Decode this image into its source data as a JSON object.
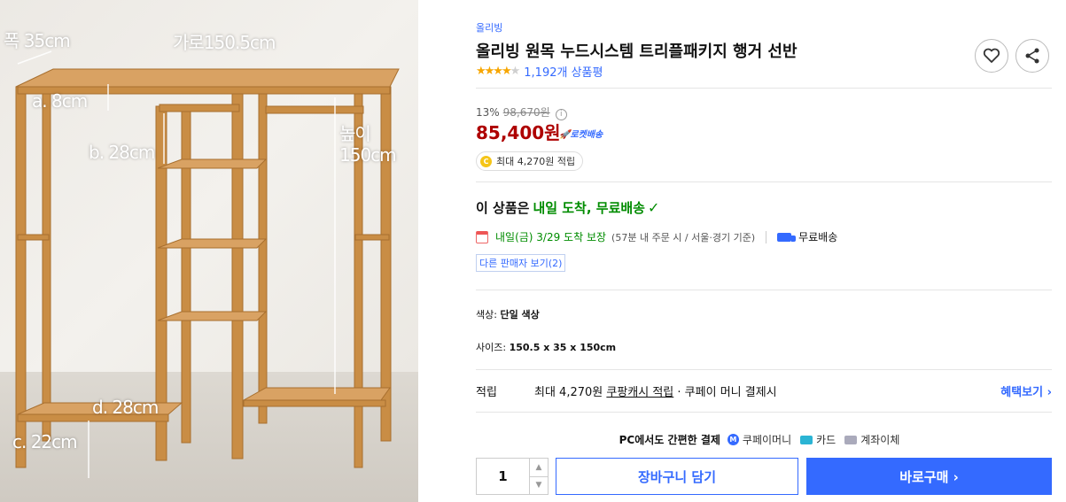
{
  "product": {
    "brand": "올리빙",
    "title": "올리빙 원목 누드시스템 트리플패키지 행거 선반",
    "rating": 4,
    "stars": "★★★★★",
    "review_count": "1,192개 상품평"
  },
  "image_dims": {
    "width": "폭 35cm",
    "length": "가로150.5cm",
    "height_label": "높이",
    "height": "150cm",
    "a": "a. 8cm",
    "b": "b. 28cm",
    "d": "d. 28cm",
    "c": "c. 22cm"
  },
  "price": {
    "discount_rate": "13%",
    "original": "98,670원",
    "info_icon": "i",
    "sale": "85,400원",
    "rocket": "🚀로켓배송",
    "points_coin": "C",
    "points": "최대 4,270원 적립"
  },
  "delivery": {
    "headline_prefix": "이 상품은",
    "headline_green": "내일 도착, 무료배송",
    "check": "✓",
    "date": "내일(금) 3/29 도착 보장",
    "note": "(57분  내 주문 시 / 서울·경기 기준)",
    "free": "무료배송",
    "other_sellers": "다른 판매자 보기(2)"
  },
  "options": {
    "color_label": "색상:",
    "color_value": "단일 색상",
    "size_label": "사이즈:",
    "size_value": "150.5 x 35 x 150cm"
  },
  "reward": {
    "label": "적립",
    "text_before": "최대 4,270원",
    "link": "쿠팡캐시 적립",
    "text_after": "· 쿠페이 머니 결제시",
    "more": "혜택보기 ›"
  },
  "payment": {
    "lead": "PC에서도 간편한 결제",
    "mcoin": "M",
    "coupay": "쿠페이머니",
    "card": "카드",
    "bank": "계좌이체"
  },
  "purchase": {
    "quantity": "1",
    "up": "▲",
    "down": "▼",
    "cart": "장바구니 담기",
    "buy": "바로구매 ›"
  },
  "colors": {
    "accent": "#346aff",
    "price": "#ae0000",
    "green": "#008c00",
    "wood": "#c98d45"
  }
}
